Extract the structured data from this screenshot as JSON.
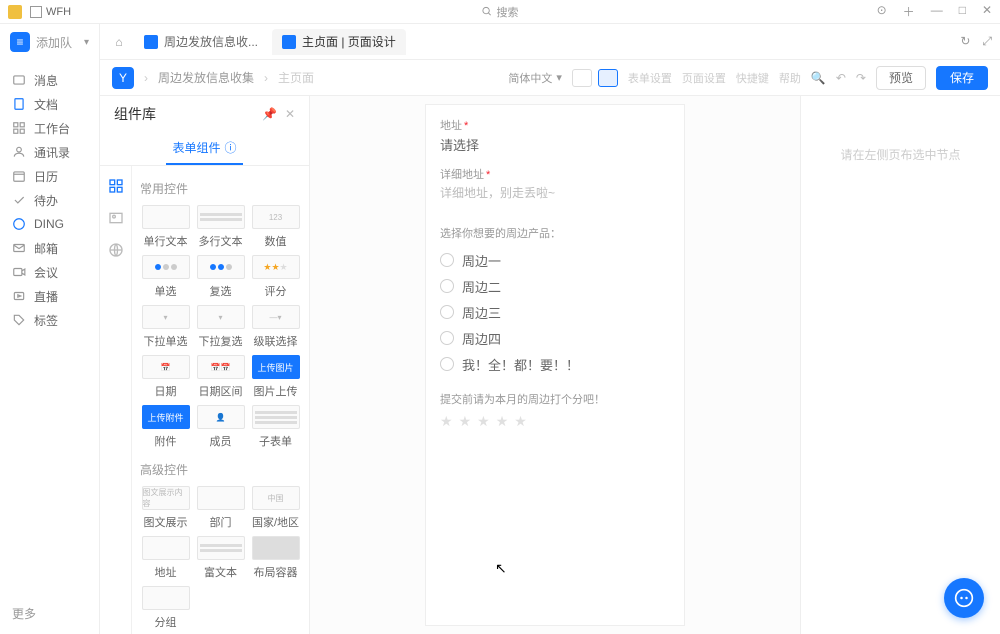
{
  "titlebar": {
    "title": "WFH",
    "search": "搜索"
  },
  "leftbar": {
    "team": "添加队",
    "items": [
      {
        "label": "消息"
      },
      {
        "label": "文档"
      },
      {
        "label": "工作台"
      },
      {
        "label": "通讯录"
      },
      {
        "label": "日历"
      },
      {
        "label": "待办"
      },
      {
        "label": "DING"
      },
      {
        "label": "邮箱"
      },
      {
        "label": "会议"
      },
      {
        "label": "直播"
      },
      {
        "label": "标签"
      }
    ],
    "more": "更多"
  },
  "tabs": {
    "tab1": "周边发放信息收...",
    "tab2": "主贞面 | 页面设计"
  },
  "toolbar": {
    "crumb1": "周边发放信息收集",
    "crumb2": "主页面",
    "lang": "简体中文",
    "link1": "表单设置",
    "link2": "页面设置",
    "link3": "快捷键",
    "link4": "帮助",
    "preview": "预览",
    "save": "保存"
  },
  "comp": {
    "title": "组件库",
    "tab": "表单组件",
    "s1": "常用控件",
    "s2": "高级控件",
    "c": {
      "single": "单行文本",
      "multi": "多行文本",
      "num": "数值",
      "radio": "单选",
      "check": "复选",
      "rate": "评分",
      "selsingle": "下拉单选",
      "selmulti": "下拉复选",
      "cascade": "级联选择",
      "date": "日期",
      "daterange": "日期区间",
      "img": "图片上传",
      "attach": "附件",
      "member": "成员",
      "sub": "子表单",
      "imgshow": "图文展示",
      "dept": "部门",
      "region": "国家/地区",
      "addr": "地址",
      "richtext": "富文本",
      "layout": "布局容器",
      "split": "分组",
      "thumb_num": "123",
      "thumb_upload": "上传图片",
      "thumb_attach": "上传附件",
      "thumb_imgshow": "图文展示内容",
      "thumb_region": "中国"
    }
  },
  "form": {
    "addr_label": "地址",
    "addr_value": "请选择",
    "detail_label": "详细地址",
    "detail_placeholder": "详细地址，别走丢啦~",
    "products_label": "选择你想要的周边产品：",
    "opts": [
      "周边一",
      "周边二",
      "周边三",
      "周边四",
      "我！全！都！要！！"
    ],
    "rating_label": "提交前请为本月的周边打个分吧！"
  },
  "right": {
    "hint": "请在左侧页布选中节点"
  }
}
